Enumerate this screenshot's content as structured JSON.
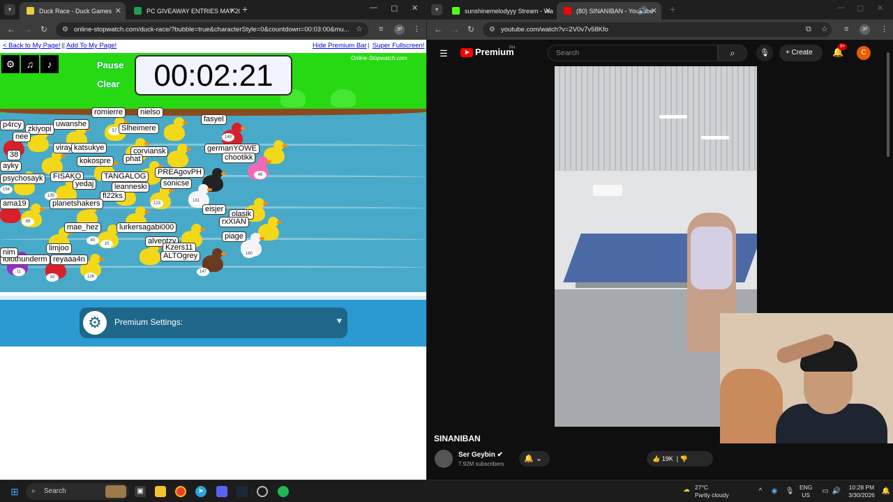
{
  "left_window": {
    "tabs": [
      {
        "title": "Duck Race - Duck Games",
        "active": true
      },
      {
        "title": "PC GIVEAWAY ENTRIES MAY 20",
        "active": false
      }
    ],
    "url": "online-stopwatch.com/duck-race/?bubble=true&characterStyle=0&countdown=00:03:00&mu...",
    "profile": "JP",
    "links": {
      "back": "< Back to My Page!",
      "add": "Add To My Page!",
      "hide": "Hide Premium Bar",
      "fullscreen": "Super Fullscreen!"
    },
    "race": {
      "pause": "Pause",
      "clear": "Clear",
      "timer": "00:02:21",
      "brand": "Online-Stopwatch.com",
      "racers": [
        "romierre",
        "nielso",
        "fasyel",
        "p4rcy",
        "zkiyopi",
        "uwanshe",
        "Slheimere",
        "nee",
        "viray",
        "katsukye",
        "corviansk",
        "germanYOWE",
        "38",
        "kokospre",
        "phat",
        "chootikk",
        "ayky",
        "PREAgovPH",
        "psychosayk",
        "FISAKO",
        "TANGALOG",
        "yedaj",
        "leanneski",
        "sonicse",
        "ama19",
        "fl22ks",
        "planetshakers",
        "eisjer",
        "olasik",
        "mae_hez",
        "lurkersagabi000",
        "rxXIAN",
        "piage",
        "alventzy",
        "limjoo",
        "Kzers11",
        "ALTOgrey",
        "lolothunderm",
        "reyaaa4n",
        "nim"
      ],
      "numbers": [
        "57",
        "149",
        "48",
        "154",
        "135",
        "123",
        "131",
        "89",
        "10",
        "40",
        "160",
        "11",
        "33",
        "126",
        "147"
      ]
    },
    "premium_settings": "Premium Settings:"
  },
  "right_window": {
    "tabs": [
      {
        "title": "sunshinemelodyyy Stream - Wa",
        "active": false
      },
      {
        "title": "(80) SINANIBAN - YouTube",
        "active": true
      }
    ],
    "url": "youtube.com/watch?v=2V0v7v58Kfo",
    "profile": "JP",
    "youtube": {
      "brand": "Premium",
      "country": "PH",
      "search_placeholder": "Search",
      "create": "Create",
      "notifications": "9+",
      "avatar_letter": "C",
      "video_title": "SINANIBAN",
      "channel": "Ser Geybin",
      "subscribers": "7.92M subscribers",
      "likes": "19K"
    }
  },
  "taskbar": {
    "search": "Search",
    "weather_temp": "27°C",
    "weather_desc": "Partly cloudy",
    "lang": "ENG",
    "region": "US",
    "time": "10:28 PM",
    "date": "3/30/2026"
  }
}
